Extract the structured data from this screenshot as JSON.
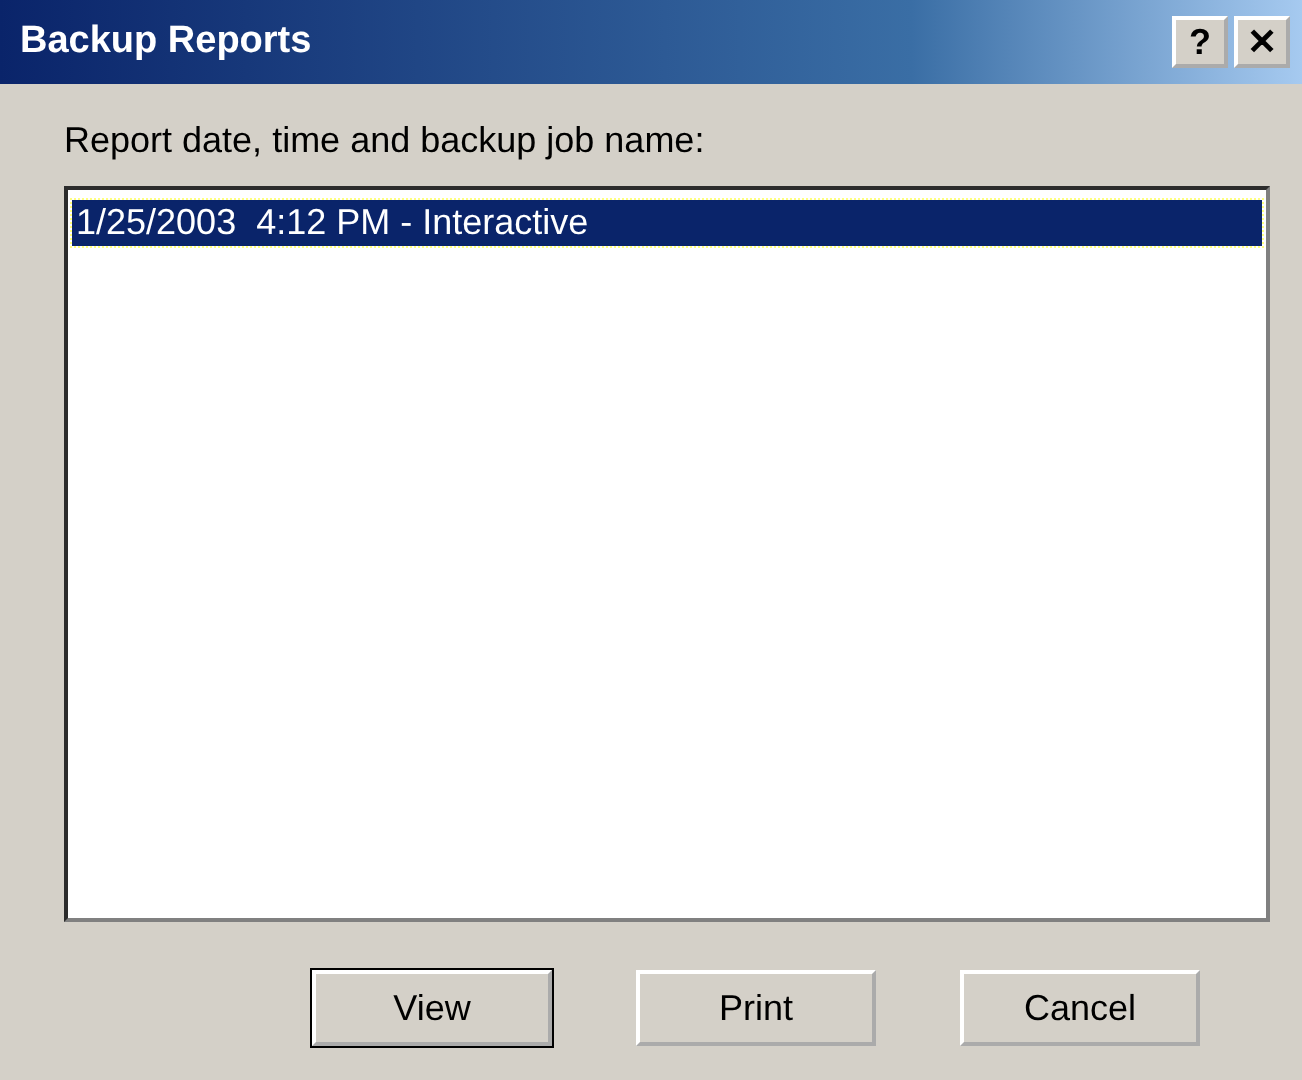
{
  "window": {
    "title": "Backup Reports",
    "help_button": "?",
    "close_button": "✕"
  },
  "list_label": "Report date, time and backup job name:",
  "reports": [
    {
      "text": "1/25/2003  4:12 PM - Interactive",
      "selected": true
    }
  ],
  "buttons": [
    {
      "label": "View",
      "default": true
    },
    {
      "label": "Print",
      "default": false
    },
    {
      "label": "Cancel",
      "default": false
    }
  ]
}
